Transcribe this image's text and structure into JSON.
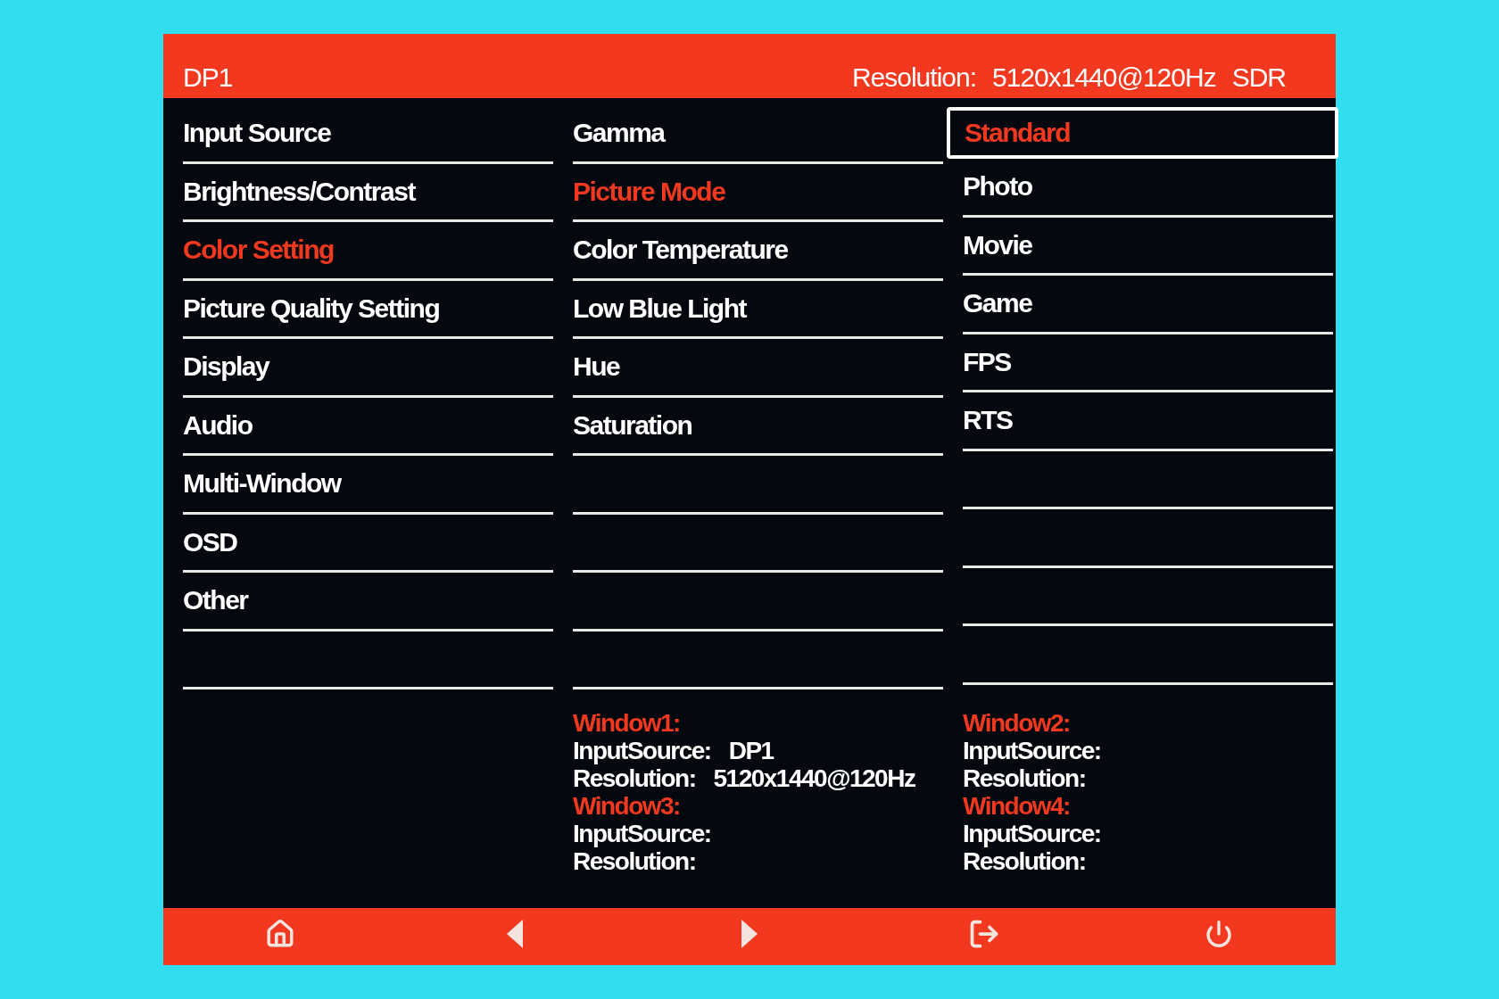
{
  "header": {
    "source": "DP1",
    "resolution_label": "Resolution:",
    "resolution_value": "5120x1440@120Hz",
    "dynamic_range": "SDR"
  },
  "columns": [
    {
      "kind": "menu",
      "items": [
        {
          "label": "Input Source",
          "selected": false
        },
        {
          "label": "Brightness/Contrast",
          "selected": false
        },
        {
          "label": "Color Setting",
          "selected": true
        },
        {
          "label": "Picture Quality Setting",
          "selected": false
        },
        {
          "label": "Display",
          "selected": false
        },
        {
          "label": "Audio",
          "selected": false
        },
        {
          "label": "Multi-Window",
          "selected": false
        },
        {
          "label": "OSD",
          "selected": false
        },
        {
          "label": "Other",
          "selected": false
        }
      ]
    },
    {
      "kind": "menu",
      "items": [
        {
          "label": "Gamma",
          "selected": false
        },
        {
          "label": "Picture Mode",
          "selected": true
        },
        {
          "label": "Color Temperature",
          "selected": false
        },
        {
          "label": "Low Blue Light",
          "selected": false
        },
        {
          "label": "Hue",
          "selected": false
        },
        {
          "label": "Saturation",
          "selected": false
        }
      ]
    },
    {
      "kind": "options",
      "items": [
        {
          "label": "Standard",
          "selected": true
        },
        {
          "label": "Photo",
          "selected": false
        },
        {
          "label": "Movie",
          "selected": false
        },
        {
          "label": "Game",
          "selected": false
        },
        {
          "label": "FPS",
          "selected": false
        },
        {
          "label": "RTS",
          "selected": false
        }
      ]
    }
  ],
  "windows": [
    {
      "title": "Window1:",
      "rows": [
        {
          "label": "InputSource:",
          "value": "DP1"
        },
        {
          "label": "Resolution:",
          "value": "5120x1440@120Hz"
        }
      ]
    },
    {
      "title": "Window2:",
      "rows": [
        {
          "label": "InputSource:"
        },
        {
          "label": "Resolution:"
        }
      ]
    },
    {
      "title": "Window3:",
      "rows": [
        {
          "label": "InputSource:"
        },
        {
          "label": "Resolution:"
        }
      ]
    },
    {
      "title": "Window4:",
      "rows": [
        {
          "label": "InputSource:"
        },
        {
          "label": "Resolution:"
        }
      ]
    }
  ],
  "footer": {
    "buttons": [
      {
        "kind": "home"
      },
      {
        "kind": "left"
      },
      {
        "kind": "right"
      },
      {
        "kind": "exit"
      },
      {
        "kind": "power"
      }
    ]
  }
}
